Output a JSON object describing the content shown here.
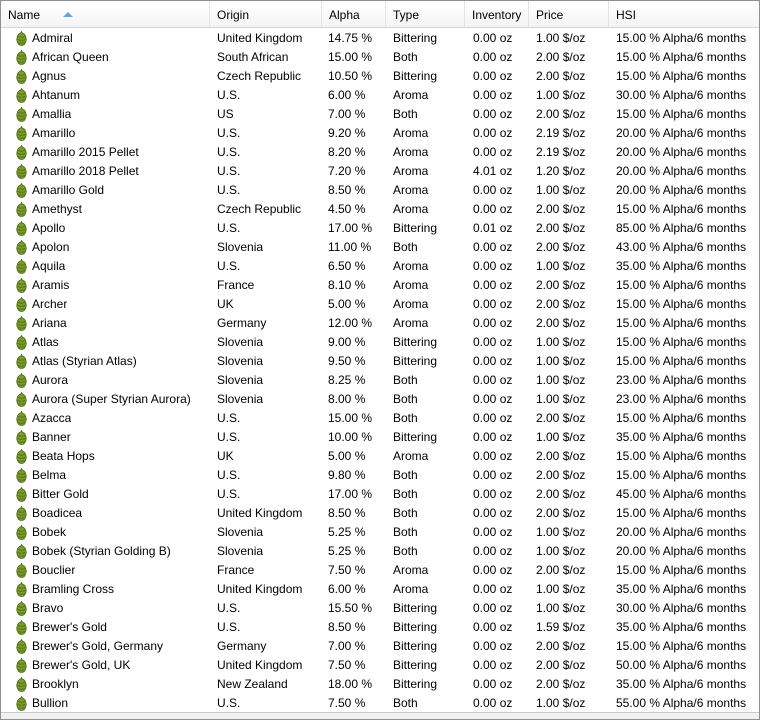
{
  "columns": {
    "name": "Name",
    "origin": "Origin",
    "alpha": "Alpha",
    "type": "Type",
    "inventory": "Inventory",
    "price": "Price",
    "hsi": "HSI"
  },
  "icons": {
    "row_icon": "hop-icon",
    "sort_icon": "sort-ascending-icon"
  },
  "colors": {
    "hop_fill": "#7a9a2e",
    "hop_dark": "#4f6a18",
    "sort_arrow": "#6ca0d6"
  },
  "hops": [
    {
      "name": "Admiral",
      "origin": "United Kingdom",
      "alpha": "14.75 %",
      "type": "Bittering",
      "inventory": "0.00 oz",
      "price": "1.00 $/oz",
      "hsi": "15.00 % Alpha/6 months"
    },
    {
      "name": "African Queen",
      "origin": "South African",
      "alpha": "15.00 %",
      "type": "Both",
      "inventory": "0.00 oz",
      "price": "2.00 $/oz",
      "hsi": "15.00 % Alpha/6 months"
    },
    {
      "name": "Agnus",
      "origin": "Czech Republic",
      "alpha": "10.50 %",
      "type": "Bittering",
      "inventory": "0.00 oz",
      "price": "2.00 $/oz",
      "hsi": "15.00 % Alpha/6 months"
    },
    {
      "name": "Ahtanum",
      "origin": "U.S.",
      "alpha": "6.00 %",
      "type": "Aroma",
      "inventory": "0.00 oz",
      "price": "1.00 $/oz",
      "hsi": "30.00 % Alpha/6 months"
    },
    {
      "name": "Amallia",
      "origin": "US",
      "alpha": "7.00 %",
      "type": "Both",
      "inventory": "0.00 oz",
      "price": "2.00 $/oz",
      "hsi": "15.00 % Alpha/6 months"
    },
    {
      "name": "Amarillo",
      "origin": "U.S.",
      "alpha": "9.20 %",
      "type": "Aroma",
      "inventory": "0.00 oz",
      "price": "2.19 $/oz",
      "hsi": "20.00 % Alpha/6 months"
    },
    {
      "name": "Amarillo 2015 Pellet",
      "origin": "U.S.",
      "alpha": "8.20 %",
      "type": "Aroma",
      "inventory": "0.00 oz",
      "price": "2.19 $/oz",
      "hsi": "20.00 % Alpha/6 months"
    },
    {
      "name": "Amarillo 2018 Pellet",
      "origin": "U.S.",
      "alpha": "7.20 %",
      "type": "Aroma",
      "inventory": "4.01 oz",
      "price": "1.20 $/oz",
      "hsi": "20.00 % Alpha/6 months"
    },
    {
      "name": "Amarillo Gold",
      "origin": "U.S.",
      "alpha": "8.50 %",
      "type": "Aroma",
      "inventory": "0.00 oz",
      "price": "1.00 $/oz",
      "hsi": "20.00 % Alpha/6 months"
    },
    {
      "name": "Amethyst",
      "origin": "Czech Republic",
      "alpha": "4.50 %",
      "type": "Aroma",
      "inventory": "0.00 oz",
      "price": "2.00 $/oz",
      "hsi": "15.00 % Alpha/6 months"
    },
    {
      "name": "Apollo",
      "origin": "U.S.",
      "alpha": "17.00 %",
      "type": "Bittering",
      "inventory": "0.01 oz",
      "price": "2.00 $/oz",
      "hsi": "85.00 % Alpha/6 months"
    },
    {
      "name": "Apolon",
      "origin": "Slovenia",
      "alpha": "11.00 %",
      "type": "Both",
      "inventory": "0.00 oz",
      "price": "2.00 $/oz",
      "hsi": "43.00 % Alpha/6 months"
    },
    {
      "name": "Aquila",
      "origin": "U.S.",
      "alpha": "6.50 %",
      "type": "Aroma",
      "inventory": "0.00 oz",
      "price": "1.00 $/oz",
      "hsi": "35.00 % Alpha/6 months"
    },
    {
      "name": "Aramis",
      "origin": "France",
      "alpha": "8.10 %",
      "type": "Aroma",
      "inventory": "0.00 oz",
      "price": "2.00 $/oz",
      "hsi": "15.00 % Alpha/6 months"
    },
    {
      "name": "Archer",
      "origin": "UK",
      "alpha": "5.00 %",
      "type": "Aroma",
      "inventory": "0.00 oz",
      "price": "2.00 $/oz",
      "hsi": "15.00 % Alpha/6 months"
    },
    {
      "name": "Ariana",
      "origin": "Germany",
      "alpha": "12.00 %",
      "type": "Aroma",
      "inventory": "0.00 oz",
      "price": "2.00 $/oz",
      "hsi": "15.00 % Alpha/6 months"
    },
    {
      "name": "Atlas",
      "origin": "Slovenia",
      "alpha": "9.00 %",
      "type": "Bittering",
      "inventory": "0.00 oz",
      "price": "1.00 $/oz",
      "hsi": "15.00 % Alpha/6 months"
    },
    {
      "name": "Atlas (Styrian Atlas)",
      "origin": "Slovenia",
      "alpha": "9.50 %",
      "type": "Bittering",
      "inventory": "0.00 oz",
      "price": "1.00 $/oz",
      "hsi": "15.00 % Alpha/6 months"
    },
    {
      "name": "Aurora",
      "origin": "Slovenia",
      "alpha": "8.25 %",
      "type": "Both",
      "inventory": "0.00 oz",
      "price": "1.00 $/oz",
      "hsi": "23.00 % Alpha/6 months"
    },
    {
      "name": "Aurora (Super Styrian Aurora)",
      "origin": "Slovenia",
      "alpha": "8.00 %",
      "type": "Both",
      "inventory": "0.00 oz",
      "price": "1.00 $/oz",
      "hsi": "23.00 % Alpha/6 months"
    },
    {
      "name": "Azacca",
      "origin": "U.S.",
      "alpha": "15.00 %",
      "type": "Both",
      "inventory": "0.00 oz",
      "price": "2.00 $/oz",
      "hsi": "15.00 % Alpha/6 months"
    },
    {
      "name": "Banner",
      "origin": "U.S.",
      "alpha": "10.00 %",
      "type": "Bittering",
      "inventory": "0.00 oz",
      "price": "1.00 $/oz",
      "hsi": "35.00 % Alpha/6 months"
    },
    {
      "name": "Beata Hops",
      "origin": "UK",
      "alpha": "5.00 %",
      "type": "Aroma",
      "inventory": "0.00 oz",
      "price": "2.00 $/oz",
      "hsi": "15.00 % Alpha/6 months"
    },
    {
      "name": "Belma",
      "origin": "U.S.",
      "alpha": "9.80 %",
      "type": "Both",
      "inventory": "0.00 oz",
      "price": "2.00 $/oz",
      "hsi": "15.00 % Alpha/6 months"
    },
    {
      "name": "Bitter Gold",
      "origin": "U.S.",
      "alpha": "17.00 %",
      "type": "Both",
      "inventory": "0.00 oz",
      "price": "2.00 $/oz",
      "hsi": "45.00 % Alpha/6 months"
    },
    {
      "name": "Boadicea",
      "origin": "United Kingdom",
      "alpha": "8.50 %",
      "type": "Both",
      "inventory": "0.00 oz",
      "price": "2.00 $/oz",
      "hsi": "15.00 % Alpha/6 months"
    },
    {
      "name": "Bobek",
      "origin": "Slovenia",
      "alpha": "5.25 %",
      "type": "Both",
      "inventory": "0.00 oz",
      "price": "1.00 $/oz",
      "hsi": "20.00 % Alpha/6 months"
    },
    {
      "name": "Bobek (Styrian Golding B)",
      "origin": "Slovenia",
      "alpha": "5.25 %",
      "type": "Both",
      "inventory": "0.00 oz",
      "price": "1.00 $/oz",
      "hsi": "20.00 % Alpha/6 months"
    },
    {
      "name": "Bouclier",
      "origin": "France",
      "alpha": "7.50 %",
      "type": "Aroma",
      "inventory": "0.00 oz",
      "price": "2.00 $/oz",
      "hsi": "15.00 % Alpha/6 months"
    },
    {
      "name": "Bramling Cross",
      "origin": "United Kingdom",
      "alpha": "6.00 %",
      "type": "Aroma",
      "inventory": "0.00 oz",
      "price": "1.00 $/oz",
      "hsi": "35.00 % Alpha/6 months"
    },
    {
      "name": "Bravo",
      "origin": "U.S.",
      "alpha": "15.50 %",
      "type": "Bittering",
      "inventory": "0.00 oz",
      "price": "1.00 $/oz",
      "hsi": "30.00 % Alpha/6 months"
    },
    {
      "name": "Brewer's Gold",
      "origin": "U.S.",
      "alpha": "8.50 %",
      "type": "Bittering",
      "inventory": "0.00 oz",
      "price": "1.59 $/oz",
      "hsi": "35.00 % Alpha/6 months"
    },
    {
      "name": "Brewer's Gold, Germany",
      "origin": "Germany",
      "alpha": "7.00 %",
      "type": "Bittering",
      "inventory": "0.00 oz",
      "price": "2.00 $/oz",
      "hsi": "15.00 % Alpha/6 months"
    },
    {
      "name": "Brewer's Gold, UK",
      "origin": "United Kingdom",
      "alpha": "7.50 %",
      "type": "Bittering",
      "inventory": "0.00 oz",
      "price": "2.00 $/oz",
      "hsi": "50.00 % Alpha/6 months"
    },
    {
      "name": "Brooklyn",
      "origin": "New Zealand",
      "alpha": "18.00 %",
      "type": "Bittering",
      "inventory": "0.00 oz",
      "price": "2.00 $/oz",
      "hsi": "35.00 % Alpha/6 months"
    },
    {
      "name": "Bullion",
      "origin": "U.S.",
      "alpha": "7.50 %",
      "type": "Both",
      "inventory": "0.00 oz",
      "price": "1.00 $/oz",
      "hsi": "55.00 % Alpha/6 months"
    }
  ]
}
